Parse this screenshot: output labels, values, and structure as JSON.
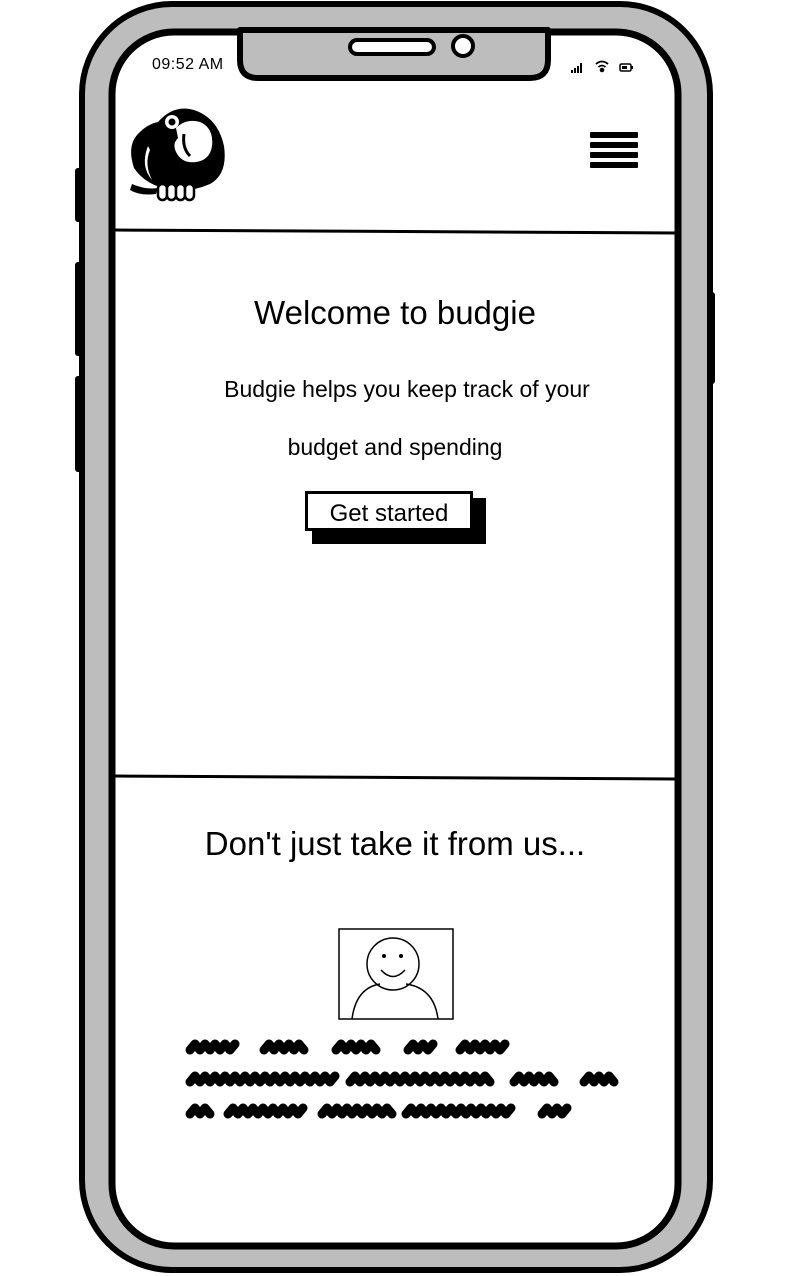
{
  "status_bar": {
    "time": "09:52 AM",
    "icons": [
      "signal-icon",
      "wifi-icon",
      "battery-icon"
    ]
  },
  "header": {
    "logo": "budgie-parrot-logo",
    "menu_icon": "hamburger-menu-icon"
  },
  "hero": {
    "title": "Welcome to budgie",
    "description_line1": "Budgie helps you keep track of your",
    "description_line2": "budget and spending",
    "cta_label": "Get started"
  },
  "testimonials": {
    "title": "Don't just take it from us...",
    "avatar": "user-avatar-placeholder",
    "quote_text": "placeholder-scribble"
  },
  "colors": {
    "frame_fill": "#bdbdbd",
    "stroke": "#000000",
    "screen": "#ffffff"
  }
}
